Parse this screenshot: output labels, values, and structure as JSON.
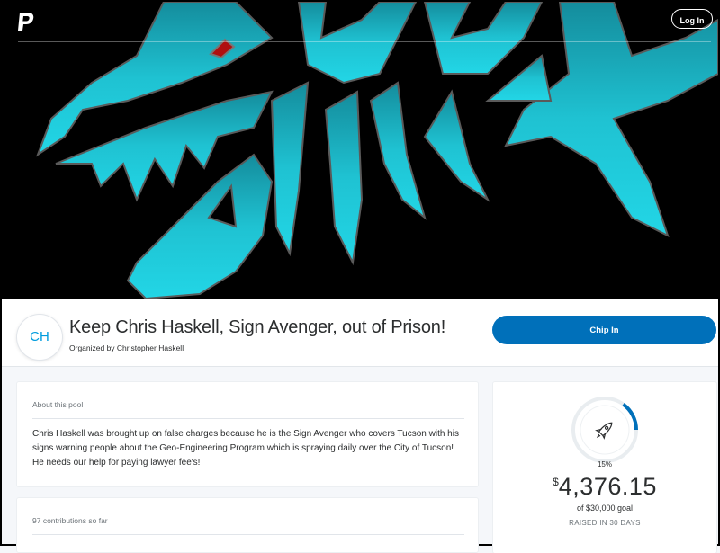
{
  "header": {
    "login_label": "Log In"
  },
  "pool": {
    "avatar_initials": "CH",
    "title": "Keep Chris Haskell, Sign Avenger, out of Prison!",
    "organizer": "Organized by Christopher Haskell",
    "chip_in_label": "Chip In"
  },
  "about": {
    "label": "About this pool",
    "text": "Chris Haskell was brought up on false charges because he is the Sign Avenger who covers Tucson with his signs warning people about the Geo-Engineering Program which is spraying daily over the City of Tucson! He needs our help for paying lawyer fee's!"
  },
  "contributions": {
    "label": "97 contributions so far"
  },
  "progress": {
    "percent_label": "15%",
    "percent": 15,
    "currency_symbol": "$",
    "raised_amount": "4,376.15",
    "goal_text": "of $30,000 goal",
    "days_text": "RAISED IN 30 DAYS",
    "ring_color": "#0070ba",
    "icon": "rocket-icon"
  },
  "colors": {
    "brand_blue": "#0070ba",
    "accent_cyan": "#20c4d4"
  }
}
